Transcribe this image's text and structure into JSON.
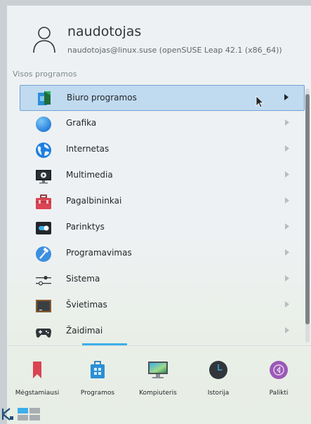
{
  "user": {
    "name": "naudotojas",
    "subtitle": "naudotojas@linux.suse (openSUSE Leap 42.1 (x86_64))"
  },
  "section_label": "Visos programos",
  "items": [
    {
      "label": "Biuro programos",
      "icon": "office-icon",
      "active": true
    },
    {
      "label": "Grafika",
      "icon": "graphics-icon"
    },
    {
      "label": "Internetas",
      "icon": "internet-icon"
    },
    {
      "label": "Multimedia",
      "icon": "multimedia-icon"
    },
    {
      "label": "Pagalbininkai",
      "icon": "utilities-icon"
    },
    {
      "label": "Parinktys",
      "icon": "settings-icon"
    },
    {
      "label": "Programavimas",
      "icon": "development-icon"
    },
    {
      "label": "Sistema",
      "icon": "system-icon"
    },
    {
      "label": "Švietimas",
      "icon": "education-icon"
    },
    {
      "label": "Žaidimai",
      "icon": "games-icon"
    }
  ],
  "tabs": [
    {
      "label": "Mėgstamiausi",
      "icon": "bookmark-icon"
    },
    {
      "label": "Programos",
      "icon": "applications-icon",
      "active": true
    },
    {
      "label": "Kompiuteris",
      "icon": "computer-icon"
    },
    {
      "label": "Istorija",
      "icon": "clock-icon"
    },
    {
      "label": "Palikti",
      "icon": "leave-icon"
    }
  ],
  "colors": {
    "accent": "#3daee9",
    "selection_bg": "#c0daf0",
    "selection_border": "#6fa3d4"
  }
}
